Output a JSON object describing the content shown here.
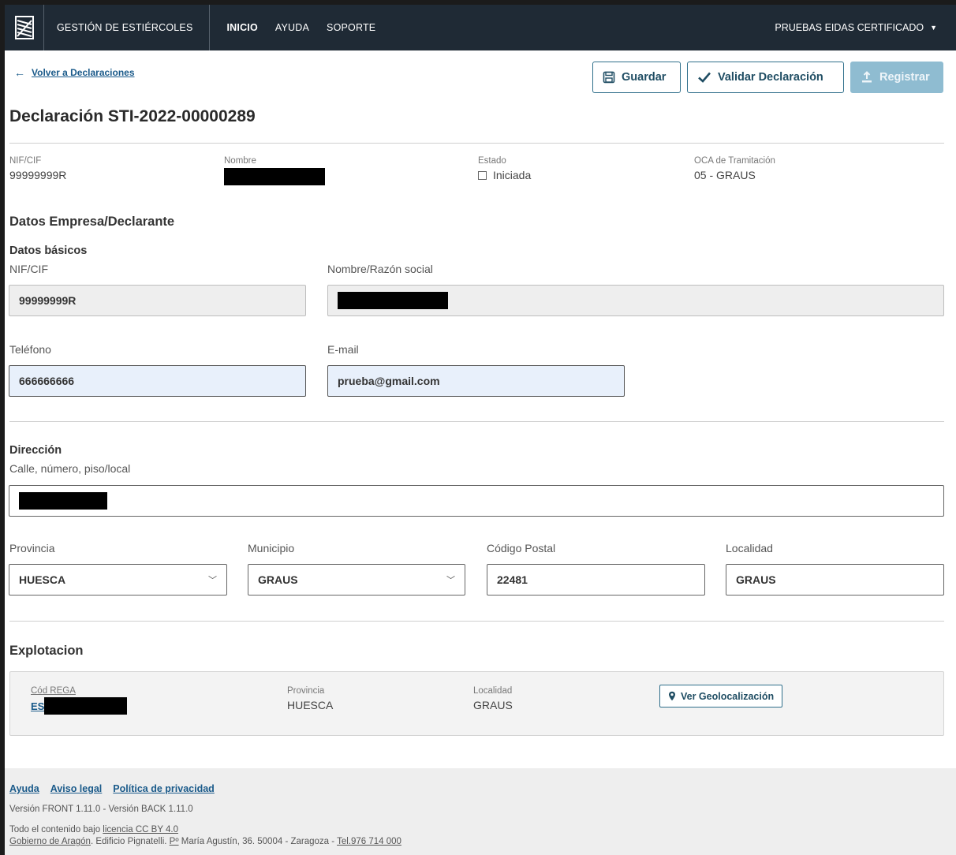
{
  "nav": {
    "app_name": "GESTIÓN DE ESTIÉRCOLES",
    "items": [
      "INICIO",
      "AYUDA",
      "SOPORTE"
    ],
    "user": "PRUEBAS EIDAS CERTIFICADO"
  },
  "back_link": "Volver a Declaraciones",
  "actions": {
    "save": "Guardar",
    "validate": "Validar Declaración",
    "register": "Registrar"
  },
  "title": "Declaración STI-2022-00000289",
  "summary": {
    "nif_label": "NIF/CIF",
    "nif_value": "99999999R",
    "name_label": "Nombre",
    "state_label": "Estado",
    "state_value": "Iniciada",
    "oca_label": "OCA de Tramitación",
    "oca_value": "05 - GRAUS"
  },
  "company": {
    "section_title": "Datos Empresa/Declarante",
    "basic_title": "Datos básicos",
    "nif_label": "NIF/CIF",
    "nif_value": "99999999R",
    "name_label": "Nombre/Razón social",
    "phone_label": "Teléfono",
    "phone_value": "666666666",
    "email_label": "E-mail",
    "email_value": "prueba@gmail.com"
  },
  "address": {
    "section_title": "Dirección",
    "street_label": "Calle, número, piso/local",
    "province_label": "Provincia",
    "province_value": "HUESCA",
    "municipality_label": "Municipio",
    "municipality_value": "GRAUS",
    "postal_label": "Código Postal",
    "postal_value": "22481",
    "locality_label": "Localidad",
    "locality_value": "GRAUS"
  },
  "exploitation": {
    "section_title": "Explotacion",
    "rega_label": "Cód REGA",
    "rega_prefix": "ES",
    "province_label": "Provincia",
    "province_value": "HUESCA",
    "locality_label": "Localidad",
    "locality_value": "GRAUS",
    "geo_button": "Ver Geolocalización"
  },
  "footer": {
    "links": [
      "Ayuda",
      "Aviso legal",
      "Política de privacidad"
    ],
    "version": "Versión FRONT 1.11.0 - Versión BACK 1.11.0",
    "license_prefix": "Todo el contenido bajo ",
    "license_link": "licencia CC BY 4.0",
    "gov_link": "Gobierno de Aragón",
    "address_mid": ". Edificio Pignatelli. ",
    "address_po": "Pº",
    "address_rest": " María Agustín, 36. 50004 - Zaragoza - ",
    "phone_link": "Tel.976 714 000"
  },
  "colors": {
    "nav_bg": "#1f2a35",
    "accent": "#2f6f8b",
    "link": "#1a5a8a",
    "disabled_btn": "#8fbcd1",
    "editable_input_bg": "#e8f0fb"
  }
}
